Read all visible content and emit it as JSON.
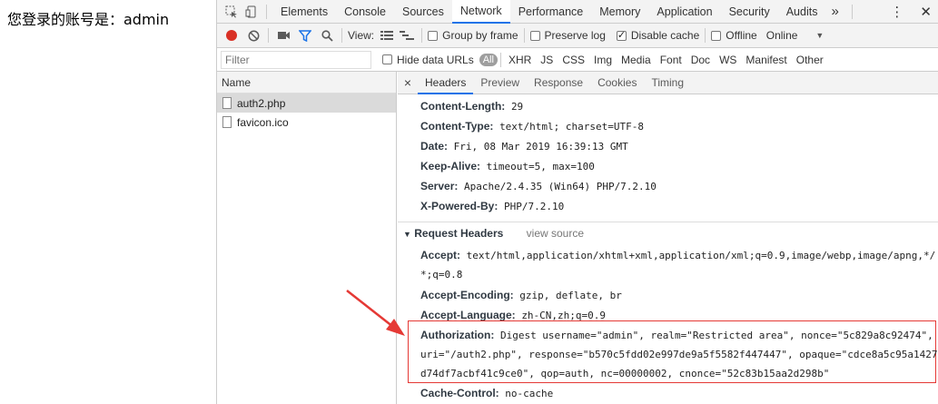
{
  "page": {
    "text": "您登录的账号是：admin"
  },
  "devtools": {
    "main_tabs": [
      "Elements",
      "Console",
      "Sources",
      "Network",
      "Performance",
      "Memory",
      "Application",
      "Security",
      "Audits"
    ],
    "active_tab": "Network",
    "more": "»",
    "toolbar2": {
      "view_label": "View:",
      "group_by_frame": "Group by frame",
      "preserve_log": "Preserve log",
      "disable_cache": "Disable cache",
      "offline": "Offline",
      "online": "Online"
    },
    "filter": {
      "placeholder": "Filter",
      "hide_data_urls": "Hide data URLs",
      "types": [
        "All",
        "XHR",
        "JS",
        "CSS",
        "Img",
        "Media",
        "Font",
        "Doc",
        "WS",
        "Manifest",
        "Other"
      ]
    },
    "request_list": {
      "column": "Name",
      "files": [
        "auth2.php",
        "favicon.ico"
      ]
    },
    "detail_tabs": [
      "Headers",
      "Preview",
      "Response",
      "Cookies",
      "Timing"
    ],
    "response_headers": [
      {
        "name": "Content-Length:",
        "value": "29"
      },
      {
        "name": "Content-Type:",
        "value": "text/html; charset=UTF-8"
      },
      {
        "name": "Date:",
        "value": "Fri, 08 Mar 2019 16:39:13 GMT"
      },
      {
        "name": "Keep-Alive:",
        "value": "timeout=5, max=100"
      },
      {
        "name": "Server:",
        "value": "Apache/2.4.35 (Win64) PHP/7.2.10"
      },
      {
        "name": "X-Powered-By:",
        "value": "PHP/7.2.10"
      }
    ],
    "request_headers_title": "Request Headers",
    "view_source": "view source",
    "request_headers": {
      "accept_name": "Accept:",
      "accept_value_1": "text/html,application/xhtml+xml,application/xml;q=0.9,image/webp,image/apng,*/",
      "accept_value_2": "*;q=0.8",
      "accept_encoding_name": "Accept-Encoding:",
      "accept_encoding_value": "gzip, deflate, br",
      "accept_language_name": "Accept-Language:",
      "accept_language_value": "zh-CN,zh;q=0.9",
      "authorization_name": "Authorization:",
      "authorization_value_1": "Digest username=\"admin\", realm=\"Restricted area\", nonce=\"5c829a8c92474\",",
      "authorization_value_2": "uri=\"/auth2.php\", response=\"b570c5fdd02e997de9a5f5582f447447\", opaque=\"cdce8a5c95a1427",
      "authorization_value_3": "d74df7acbf41c9ce0\", qop=auth, nc=00000002, cnonce=\"52c83b15aa2d298b\"",
      "cache_control_name": "Cache-Control:",
      "cache_control_value": "no-cache"
    },
    "colors": {
      "accent": "#1a73e8",
      "record": "#d93025",
      "highlight": "#e53935"
    }
  }
}
